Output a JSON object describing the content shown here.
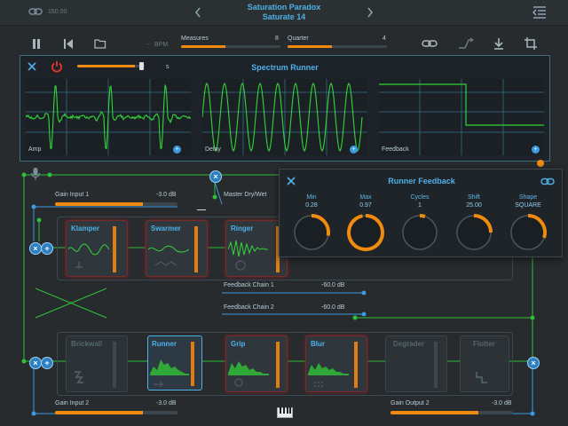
{
  "header": {
    "link_value": "150.00",
    "preset_line1": "Saturation Paradox",
    "preset_line2": "Saturate 14",
    "bpm_label": "BPM",
    "measures_label": "Measures",
    "measures_value": "8",
    "measures_level": 0.45,
    "quarter_label": "Quarter",
    "quarter_value": "4",
    "quarter_level": 0.45
  },
  "spectrum": {
    "title": "Spectrum Runner",
    "slider_label": "S",
    "slider_level": 0.85,
    "graphs": [
      {
        "label": "Amp"
      },
      {
        "label": "Delay"
      },
      {
        "label": "Feedback"
      }
    ]
  },
  "routing": {
    "gain_input_1_label": "Gain Input 1",
    "gain_input_1_value": "-3.0 dB",
    "gain_input_1_level": 0.72,
    "master_label": "Master Dry/Wet",
    "feedback_chain_1_label": "Feedback Chain 1",
    "feedback_chain_1_value": "-60.0 dB",
    "feedback_chain_2_label": "Feedback Chain 2",
    "feedback_chain_2_value": "-60.0 dB",
    "gain_input_2_label": "Gain Input 2",
    "gain_input_2_value": "-3.0 dB",
    "gain_input_2_level": 0.72,
    "gain_output_2_label": "Gain Output 2",
    "gain_output_2_value": "-3.0 dB",
    "gain_output_2_level": 0.72
  },
  "chain1": [
    {
      "name": "Klamper",
      "active": true
    },
    {
      "name": "Swarmer",
      "active": true
    },
    {
      "name": "Ringer",
      "active": true
    }
  ],
  "chain2": [
    {
      "name": "Brickwall",
      "active": false
    },
    {
      "name": "Runner",
      "active": true
    },
    {
      "name": "Grip",
      "active": true
    },
    {
      "name": "Blur",
      "active": true
    },
    {
      "name": "Degrader",
      "active": false
    },
    {
      "name": "Flutter",
      "active": false
    }
  ],
  "feedback_popup": {
    "title": "Runner Feedback",
    "knobs": [
      {
        "label": "Min",
        "value": "0.28",
        "level": 0.28
      },
      {
        "label": "Max",
        "value": "0.97",
        "level": 0.97
      },
      {
        "label": "Cycles",
        "value": "1",
        "level": 0.05
      },
      {
        "label": "Shift",
        "value": "25.00",
        "level": 0.25
      },
      {
        "label": "Shape",
        "value": "SQUARE",
        "level": 0.3
      }
    ]
  },
  "colors": {
    "accent_orange": "#f08b10",
    "accent_blue": "#4fb0ea",
    "signal_green": "#33c43a",
    "background": "#272b2e"
  }
}
